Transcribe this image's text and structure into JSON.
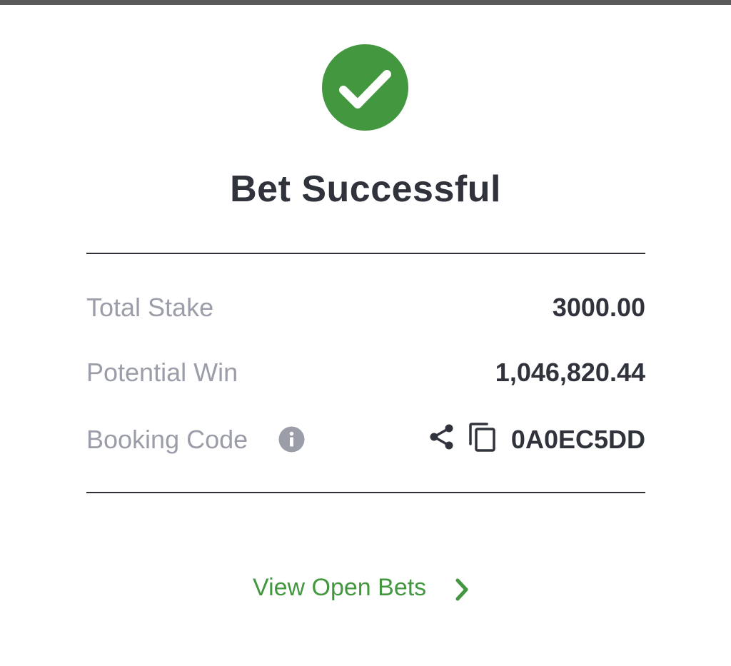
{
  "status": {
    "title": "Bet Successful",
    "icon": "checkmark-icon",
    "color": "#43973f"
  },
  "summary": {
    "total_stake_label": "Total Stake",
    "total_stake_value": "3000.00",
    "potential_win_label": "Potential Win",
    "potential_win_value": "1,046,820.44",
    "booking_code_label": "Booking Code",
    "booking_code_value": "0A0EC5DD"
  },
  "icons": {
    "info": "info-icon",
    "share": "share-icon",
    "copy": "copy-icon",
    "chevron": "chevron-right-icon"
  },
  "actions": {
    "view_open_bets_label": "View Open Bets"
  },
  "colors": {
    "accent_green": "#43973f",
    "text_dark": "#30333c",
    "text_muted": "#9b9ea8"
  }
}
